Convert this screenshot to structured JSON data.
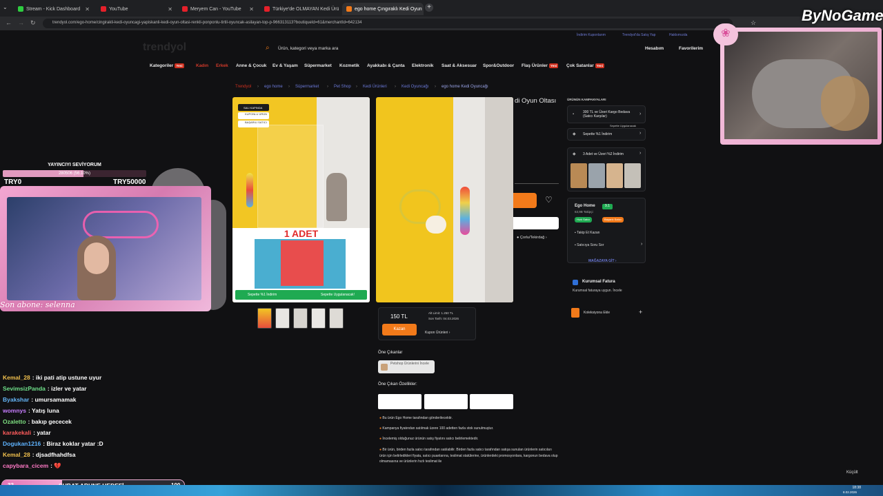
{
  "tabs": [
    {
      "label": "Stream - Kick Dashboard",
      "color": "#2ecc40"
    },
    {
      "label": "YouTube",
      "color": "#e5202a"
    },
    {
      "label": "Meryem Can - YouTube",
      "color": "#e5202a"
    },
    {
      "label": "Türkiye'de OLMAYAN Kedi Ürü",
      "color": "#e5202a"
    },
    {
      "label": "ego home Çıngıraklı Kedi Oyun",
      "color": "#f27a1a"
    }
  ],
  "address_url": "trendyol.com/ego-home/cingirakli-kedi-oyuncagi-yapiskanli-kedi-oyun-oltasi-renkli-ponponlu-tirtil-oyuncak-asilayan-top-p-966313113?boutiqueId=61&merchantId=642134",
  "site": {
    "logo": "trendyol",
    "search_placeholder": "Ürün, kategori veya marka ara",
    "top_links": [
      "İndirim Kuponlarım",
      "Trendyol'da Satış Yap",
      "Hakkımızda"
    ],
    "account": "Hesabım",
    "favorites": "Favorilerim",
    "nav": [
      {
        "label": "Kategoriler",
        "badge": "Yeni"
      },
      {
        "label": "Kadın"
      },
      {
        "label": "Erkek"
      },
      {
        "label": "Anne & Çocuk"
      },
      {
        "label": "Ev & Yaşam"
      },
      {
        "label": "Süpermarket"
      },
      {
        "label": "Kozmetik"
      },
      {
        "label": "Ayakkabı & Çanta"
      },
      {
        "label": "Elektronik"
      },
      {
        "label": "Saat & Aksesuar"
      },
      {
        "label": "Spor&Outdoor"
      },
      {
        "label": "Flaş Ürünler",
        "badge": "Yeni"
      },
      {
        "label": "Çok Satanlar",
        "badge": "Yeni"
      }
    ],
    "breadcrumb": [
      "Trendyol",
      "ego home",
      "Süpermarket",
      "Pet Shop",
      "Kedi Ürünleri",
      "Kedi Oyuncağı",
      "ego home Kedi Oyuncağı"
    ],
    "product_title_fragment": "di Oyun Oltası",
    "image1_labels": [
      "SALI KAPINDA",
      "KUPONLU ÜRÜN",
      "BAŞARILI SATICI"
    ],
    "image1_count": "1 ADET",
    "image1_bar_left": "Sepette %1 İndirim",
    "image1_bar_right": "Sepette Uygulanacak!",
    "price": "150 TL",
    "coupon_button": "Kazan",
    "coupon_info": [
      "Alt Limit: 1.250 TL",
      "Son Tarih: 04.03.2026"
    ],
    "coupon_link": "Kupon Ürünleri",
    "location": "Çorlu/Tekirdağ",
    "highlights_title": "Öne Çıkanlar",
    "highlight_chip": "Petshop Ürünlerini İncele",
    "features_title": "Öne Çıkan Özellikler:",
    "notes": [
      "Bu ürün Ego Home tarafından gönderilecektir.",
      "Kampanya fiyatından satılmak üzere 100 adetten fazla stok sunulmuştur.",
      "İncelemiş olduğunuz ürünün satış fiyatını satıcı belirlemektedir.",
      "Bir ürün, birden fazla satıcı tarafından satılabilir. Birden fazla satıcı tarafından satışa sunulan ürünlerin satıcıları ürün için belirledikleri fiyata, satıcı puanlarına, teslimat statülerine, ürünlerdeki promosyonlara, kargonun bedava olup olmamasına ve ürünlerin hızlı teslimat ile"
    ],
    "campaigns_title": "ÜRÜNÜN KAMPANYALARI",
    "campaigns": [
      "300 TL ve Üzeri Kargo Bedava (Satıcı Karşılar)",
      "Sepette %1 İndirim",
      "3 Adet ve Üzeri %2 İndirim"
    ],
    "campaign_tag": "Sepette Uygulanacak",
    "seller_name": "Ego Home",
    "seller_score": "9.1",
    "seller_followers": "63,9B Takipçi",
    "seller_tags": [
      "Hızlı Satıcı",
      "Başarılı Satıcı"
    ],
    "seller_links": [
      "Takip Et Kazan",
      "Satıcıya Soru Sor"
    ],
    "store_link": "MAĞAZAYA GİT",
    "invoice_title": "Kurumsal Fatura",
    "invoice_text": "Kurumsal faturaya uygun. İncele",
    "collection": "Koleksiyona Ekle",
    "shrink": "Küçült"
  },
  "overlay": {
    "brand": "ByNoGame",
    "level_title": "YAYINCIYI SEVİYORUM",
    "level_progress_text": "280506 (56.10%)",
    "level_progress": 0.561,
    "level_min": "TRY0",
    "level_max": "TRY50000",
    "last_sub": "Son abone: selenna",
    "goal_current": "33",
    "goal_title": "ŞUBAT ABUNE HEDEFİ",
    "goal_target": "100",
    "goal_progress": 0.33
  },
  "chat": [
    {
      "user": "Kemal_28",
      "color": "#f2c14e",
      "text": ": iki pati atip ustune uyur"
    },
    {
      "user": "SevimsizPanda",
      "color": "#6fe08a",
      "text": ": izler ve yatar"
    },
    {
      "user": "Byakshar",
      "color": "#64b5f6",
      "text": ": umursamamak"
    },
    {
      "user": "womnys",
      "color": "#c77dff",
      "text": ": Yatış luna"
    },
    {
      "user": "Ozaletto",
      "color": "#7ee081",
      "text": ": bakıp gececek"
    },
    {
      "user": "karakekali",
      "color": "#ff5c5c",
      "text": ": yatar"
    },
    {
      "user": "Dogukan1216",
      "color": "#5fb3ff",
      "text": ": Biraz koklar yatar :D"
    },
    {
      "user": "Kemal_28",
      "color": "#f2c14e",
      "text": ": djsadfhahdfsa"
    },
    {
      "user": "capybara_cicem",
      "color": "#ff7ac6",
      "text": ": 💔"
    }
  ],
  "clock": {
    "time": "18:38",
    "date": "8.02.2026"
  }
}
